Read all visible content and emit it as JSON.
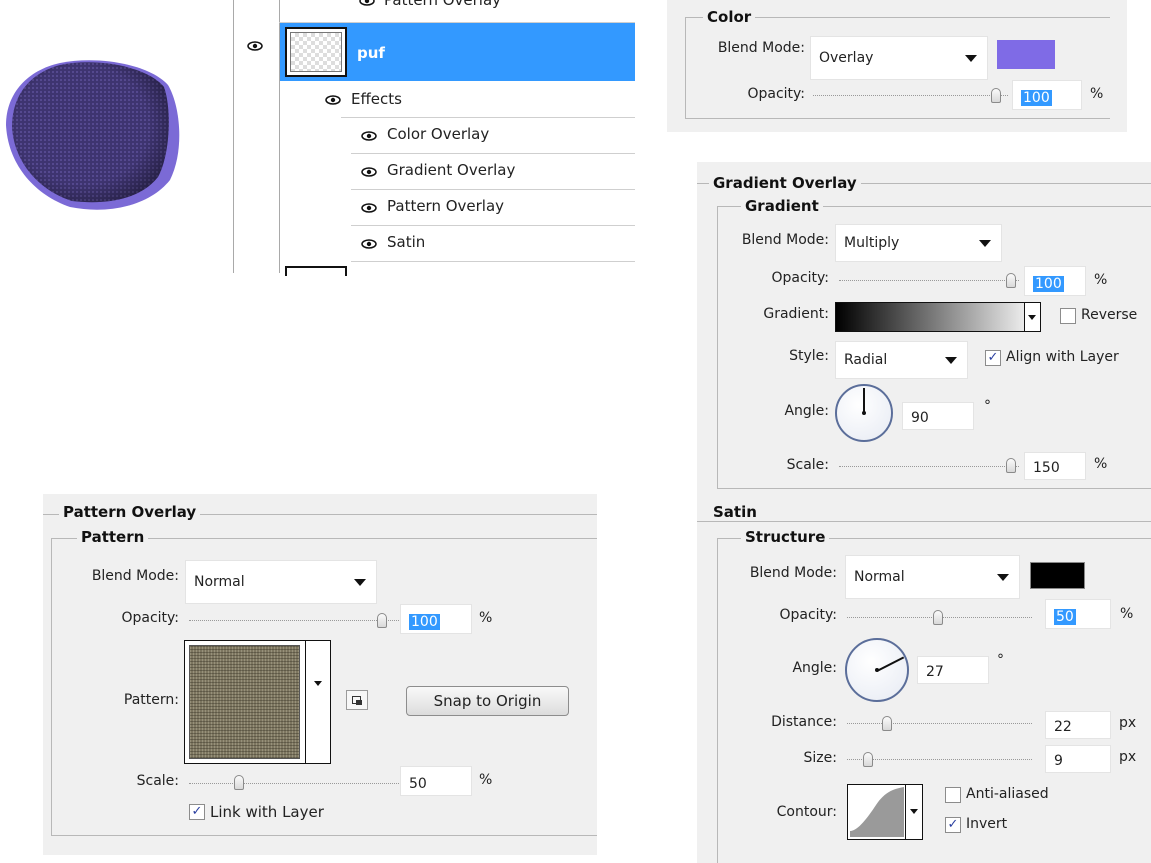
{
  "colors": {
    "puf_fill": "#4a3f7e",
    "overlay_color": "#7f6be6",
    "satin_color": "#000000",
    "selection": "#3399ff"
  },
  "layers_panel": {
    "top_partial_label": "Pattern Overlay",
    "layer_name": "puf",
    "effects_label": "Effects",
    "effects": [
      "Color Overlay",
      "Gradient Overlay",
      "Pattern Overlay",
      "Satin"
    ],
    "icons": {
      "eye": "eye-icon"
    }
  },
  "color_overlay": {
    "title": "Color",
    "blend_mode_label": "Blend Mode:",
    "blend_mode": "Overlay",
    "opacity_label": "Opacity:",
    "opacity": "100",
    "percent": "%"
  },
  "gradient_overlay": {
    "title": "Gradient Overlay",
    "group_title": "Gradient",
    "blend_mode_label": "Blend Mode:",
    "blend_mode": "Multiply",
    "opacity_label": "Opacity:",
    "opacity": "100",
    "percent": "%",
    "gradient_label": "Gradient:",
    "reverse_label": "Reverse",
    "reverse_checked": false,
    "style_label": "Style:",
    "style": "Radial",
    "align_label": "Align with Layer",
    "align_checked": true,
    "angle_label": "Angle:",
    "angle": "90",
    "degree": "°",
    "scale_label": "Scale:",
    "scale": "150",
    "scale_percent": "%"
  },
  "satin": {
    "title": "Satin",
    "group_title": "Structure",
    "blend_mode_label": "Blend Mode:",
    "blend_mode": "Normal",
    "opacity_label": "Opacity:",
    "opacity": "50",
    "percent": "%",
    "angle_label": "Angle:",
    "angle": "27",
    "degree": "°",
    "distance_label": "Distance:",
    "distance": "22",
    "distance_unit": "px",
    "size_label": "Size:",
    "size": "9",
    "size_unit": "px",
    "contour_label": "Contour:",
    "anti_aliased_label": "Anti-aliased",
    "anti_aliased_checked": false,
    "invert_label": "Invert",
    "invert_checked": true
  },
  "pattern_overlay": {
    "title": "Pattern Overlay",
    "group_title": "Pattern",
    "blend_mode_label": "Blend Mode:",
    "blend_mode": "Normal",
    "opacity_label": "Opacity:",
    "opacity": "100",
    "percent": "%",
    "pattern_label": "Pattern:",
    "snap_button": "Snap to Origin",
    "scale_label": "Scale:",
    "scale": "50",
    "scale_percent": "%",
    "link_label": "Link with Layer",
    "link_checked": true
  }
}
